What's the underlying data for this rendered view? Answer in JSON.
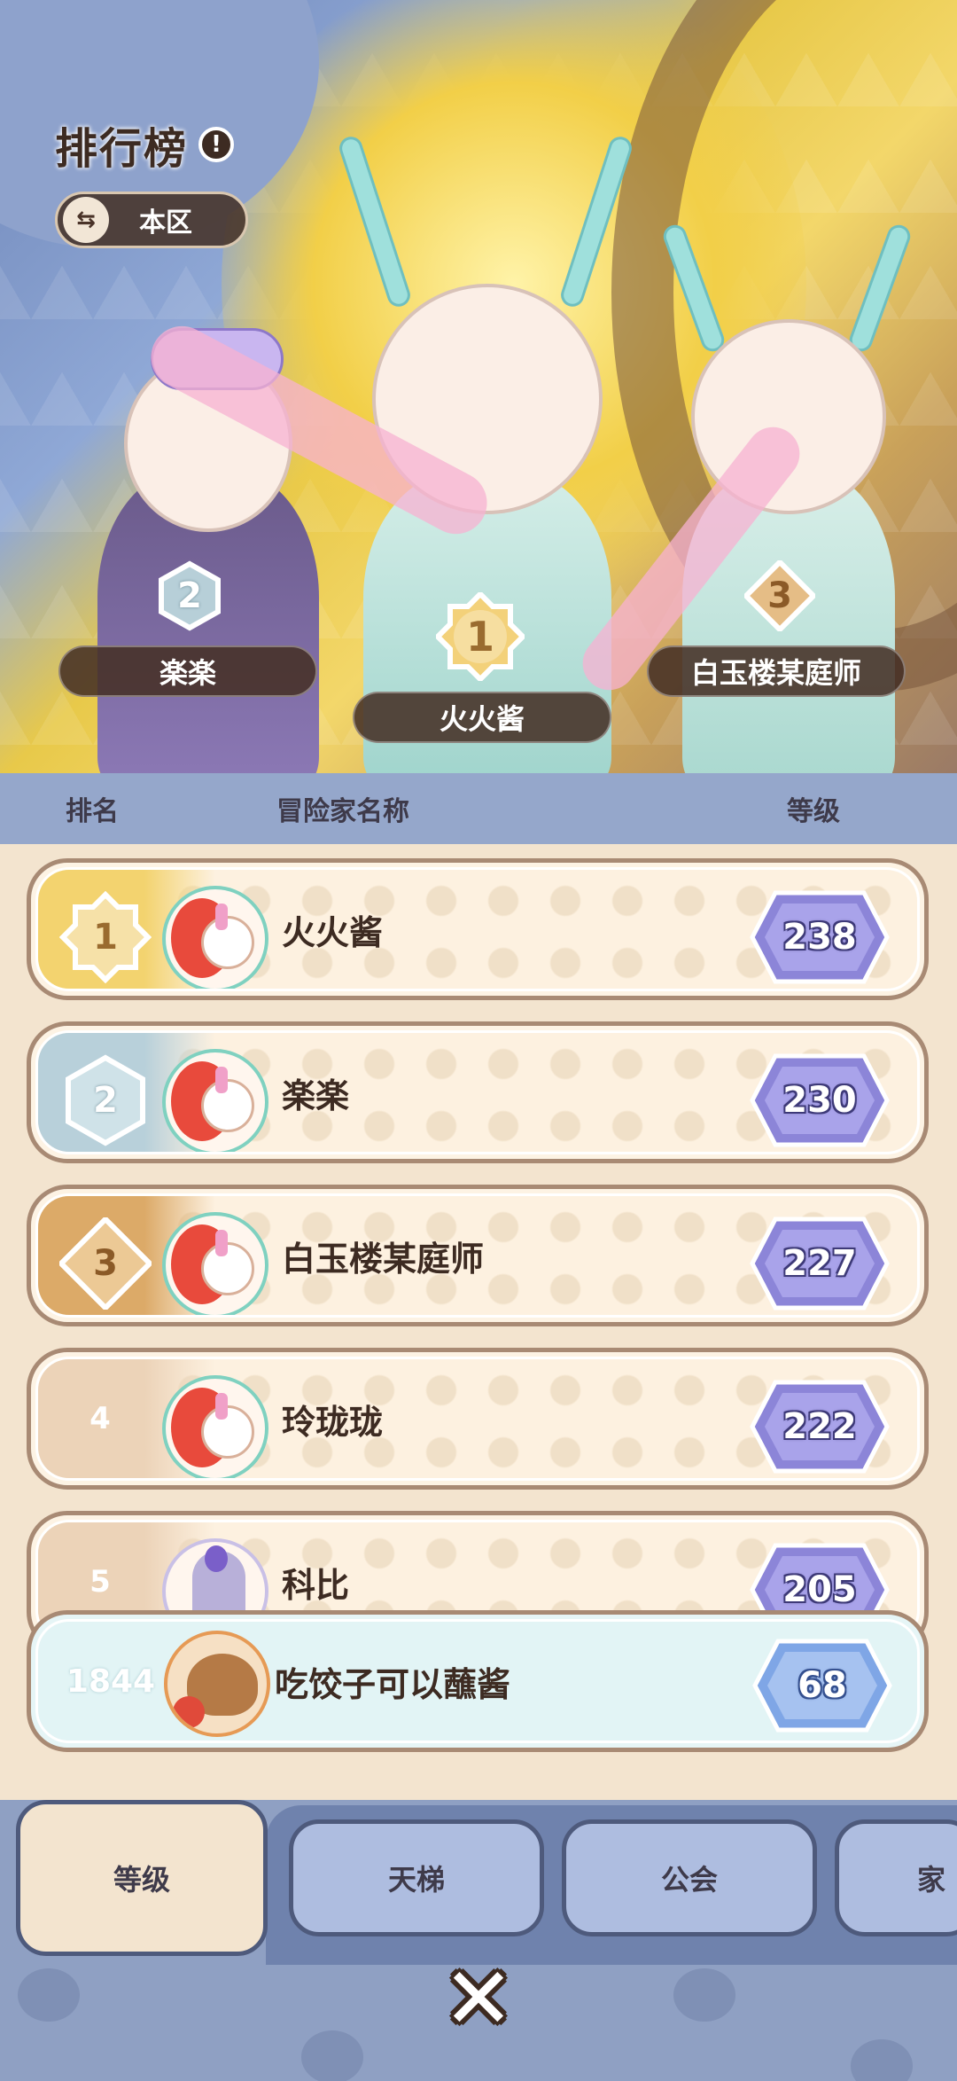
{
  "header": {
    "title": "排行榜",
    "info_icon": "info-icon",
    "region": {
      "icon": "swap-icon",
      "label": "本区"
    }
  },
  "podium": {
    "first": {
      "rank": "1",
      "name": "火火酱"
    },
    "second": {
      "rank": "2",
      "name": "楽楽"
    },
    "third": {
      "rank": "3",
      "name": "白玉楼某庭师"
    }
  },
  "columns": {
    "rank": "排名",
    "name": "冒险家名称",
    "level": "等级"
  },
  "rankings": [
    {
      "rank": "1",
      "name": "火火酱",
      "level": "238"
    },
    {
      "rank": "2",
      "name": "楽楽",
      "level": "230"
    },
    {
      "rank": "3",
      "name": "白玉楼某庭师",
      "level": "227"
    },
    {
      "rank": "4",
      "name": "玲珑珑",
      "level": "222"
    },
    {
      "rank": "5",
      "name": "科比",
      "level": "205"
    }
  ],
  "self": {
    "rank": "1844",
    "name": "吃饺子可以蘸酱",
    "level": "68"
  },
  "tabs": [
    {
      "label": "等级",
      "active": true
    },
    {
      "label": "天梯",
      "active": false
    },
    {
      "label": "公会",
      "active": false
    },
    {
      "label": "家",
      "active": false
    }
  ],
  "close_icon": "close-icon",
  "colors": {
    "gold": "#f0c75a",
    "silver": "#b7cfd8",
    "bronze": "#d9a766",
    "level_badge": "#8c85d8",
    "self_badge": "#7fa6e6"
  }
}
